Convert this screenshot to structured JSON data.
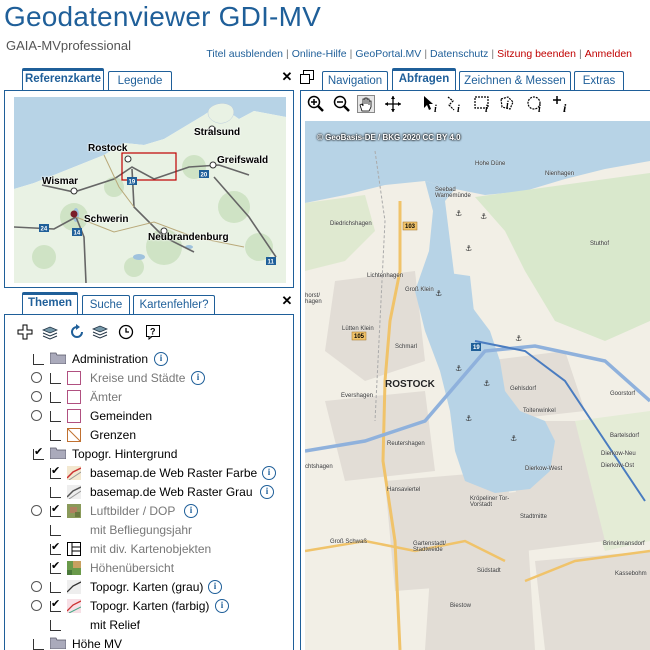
{
  "header": {
    "title": "Geodatenviewer GDI-MV",
    "subtitle": "GAIA-MVprofessional",
    "links": [
      {
        "label": "Titel ausblenden",
        "color": "blue"
      },
      {
        "label": "Online-Hilfe",
        "color": "blue"
      },
      {
        "label": "GeoPortal.MV",
        "color": "blue"
      },
      {
        "label": "Datenschutz",
        "color": "blue"
      },
      {
        "label": "Sitzung beenden",
        "color": "red"
      },
      {
        "label": "Anmelden",
        "color": "red"
      }
    ]
  },
  "colors": {
    "accent": "#1f5f99",
    "danger": "#c00000",
    "water": "#b7d3e6",
    "land": "#f2efe6"
  },
  "ref_panel": {
    "tabs": [
      "Referenzkarte",
      "Legende"
    ],
    "close": "✕",
    "cities": [
      "Stralsund",
      "Rostock",
      "Greifswald",
      "Wismar",
      "Schwerin",
      "Neubrandenburg"
    ],
    "road_badges": [
      "19",
      "20",
      "24",
      "14",
      "11"
    ]
  },
  "themes_panel": {
    "tabs": [
      "Themen",
      "Suche",
      "Kartenfehler?"
    ],
    "close": "✕",
    "toolbar_icons": [
      "add-icon",
      "layers-icon",
      "refresh-icon",
      "layers-stack-icon",
      "clock-icon",
      "help-icon"
    ],
    "tree": [
      {
        "label": "Administration",
        "kind": "folder",
        "info": true
      },
      {
        "label": "Kreise und Städte",
        "kind": "layer",
        "info": true
      },
      {
        "label": "Ämter",
        "kind": "layer",
        "info": false
      },
      {
        "label": "Gemeinden",
        "kind": "layer",
        "info": false
      },
      {
        "label": "Grenzen",
        "kind": "layer",
        "info": false
      },
      {
        "label": "Topogr. Hintergrund",
        "kind": "folder",
        "info": false
      },
      {
        "label": "basemap.de Web Raster Farbe",
        "kind": "layer",
        "info": true
      },
      {
        "label": "basemap.de Web Raster Grau",
        "kind": "layer",
        "info": true
      },
      {
        "label": "Luftbilder / DOP",
        "kind": "layer",
        "info": true
      },
      {
        "label": "mit Befliegungsjahr",
        "kind": "layer",
        "info": false
      },
      {
        "label": "mit div. Kartenobjekten",
        "kind": "layer",
        "info": false
      },
      {
        "label": "Höhenübersicht",
        "kind": "layer",
        "info": false
      },
      {
        "label": "Topogr. Karten (grau)",
        "kind": "layer",
        "info": true
      },
      {
        "label": "Topogr. Karten (farbig)",
        "kind": "layer",
        "info": true
      },
      {
        "label": "mit Relief",
        "kind": "layer",
        "info": false
      },
      {
        "label": "Höhe MV",
        "kind": "folder",
        "info": false
      }
    ],
    "info_glyph": "i"
  },
  "map_panel": {
    "tabs": [
      "Navigation",
      "Abfragen",
      "Zeichnen & Messen",
      "Extras"
    ],
    "active_tab": "Abfragen",
    "tools": [
      "zoom-in-icon",
      "zoom-out-icon",
      "pan-hand-icon",
      "move-icon",
      "info-pointer-icon",
      "info-line-icon",
      "info-rect-icon",
      "info-polygon-icon",
      "info-circle-icon",
      "info-point-icon"
    ],
    "copyright": "© GeoBasis-DE / BKG 2020 CC BY 4.0",
    "city": "ROSTOCK",
    "labels": [
      "Seebad Warnemünde",
      "Diedrichshagen",
      "Lichtenhagen",
      "Groß Klein",
      "Lütten Klein",
      "Schmarl",
      "Evershagen",
      "Reutershagen",
      "Hansaviertel",
      "Groß Schwaß",
      "Gartenstadt/ Stadtweide",
      "Kröpeliner Tor-Vorstadt",
      "Stadtmitte",
      "Südstadt",
      "Biestow",
      "Toitenwinkel",
      "Gehlsdorf",
      "Dierkow-West",
      "Dierkow-Ost",
      "Dierkow-Neu",
      "Brinckmansdorf",
      "Kassebohm",
      "Bartelsdorf",
      "Goorstorf",
      "Stuthof",
      "Nienhagen",
      "Hohe Düne",
      "horst/ hagen",
      "chtshagen"
    ],
    "route_badges": [
      "103",
      "105",
      "19"
    ]
  }
}
